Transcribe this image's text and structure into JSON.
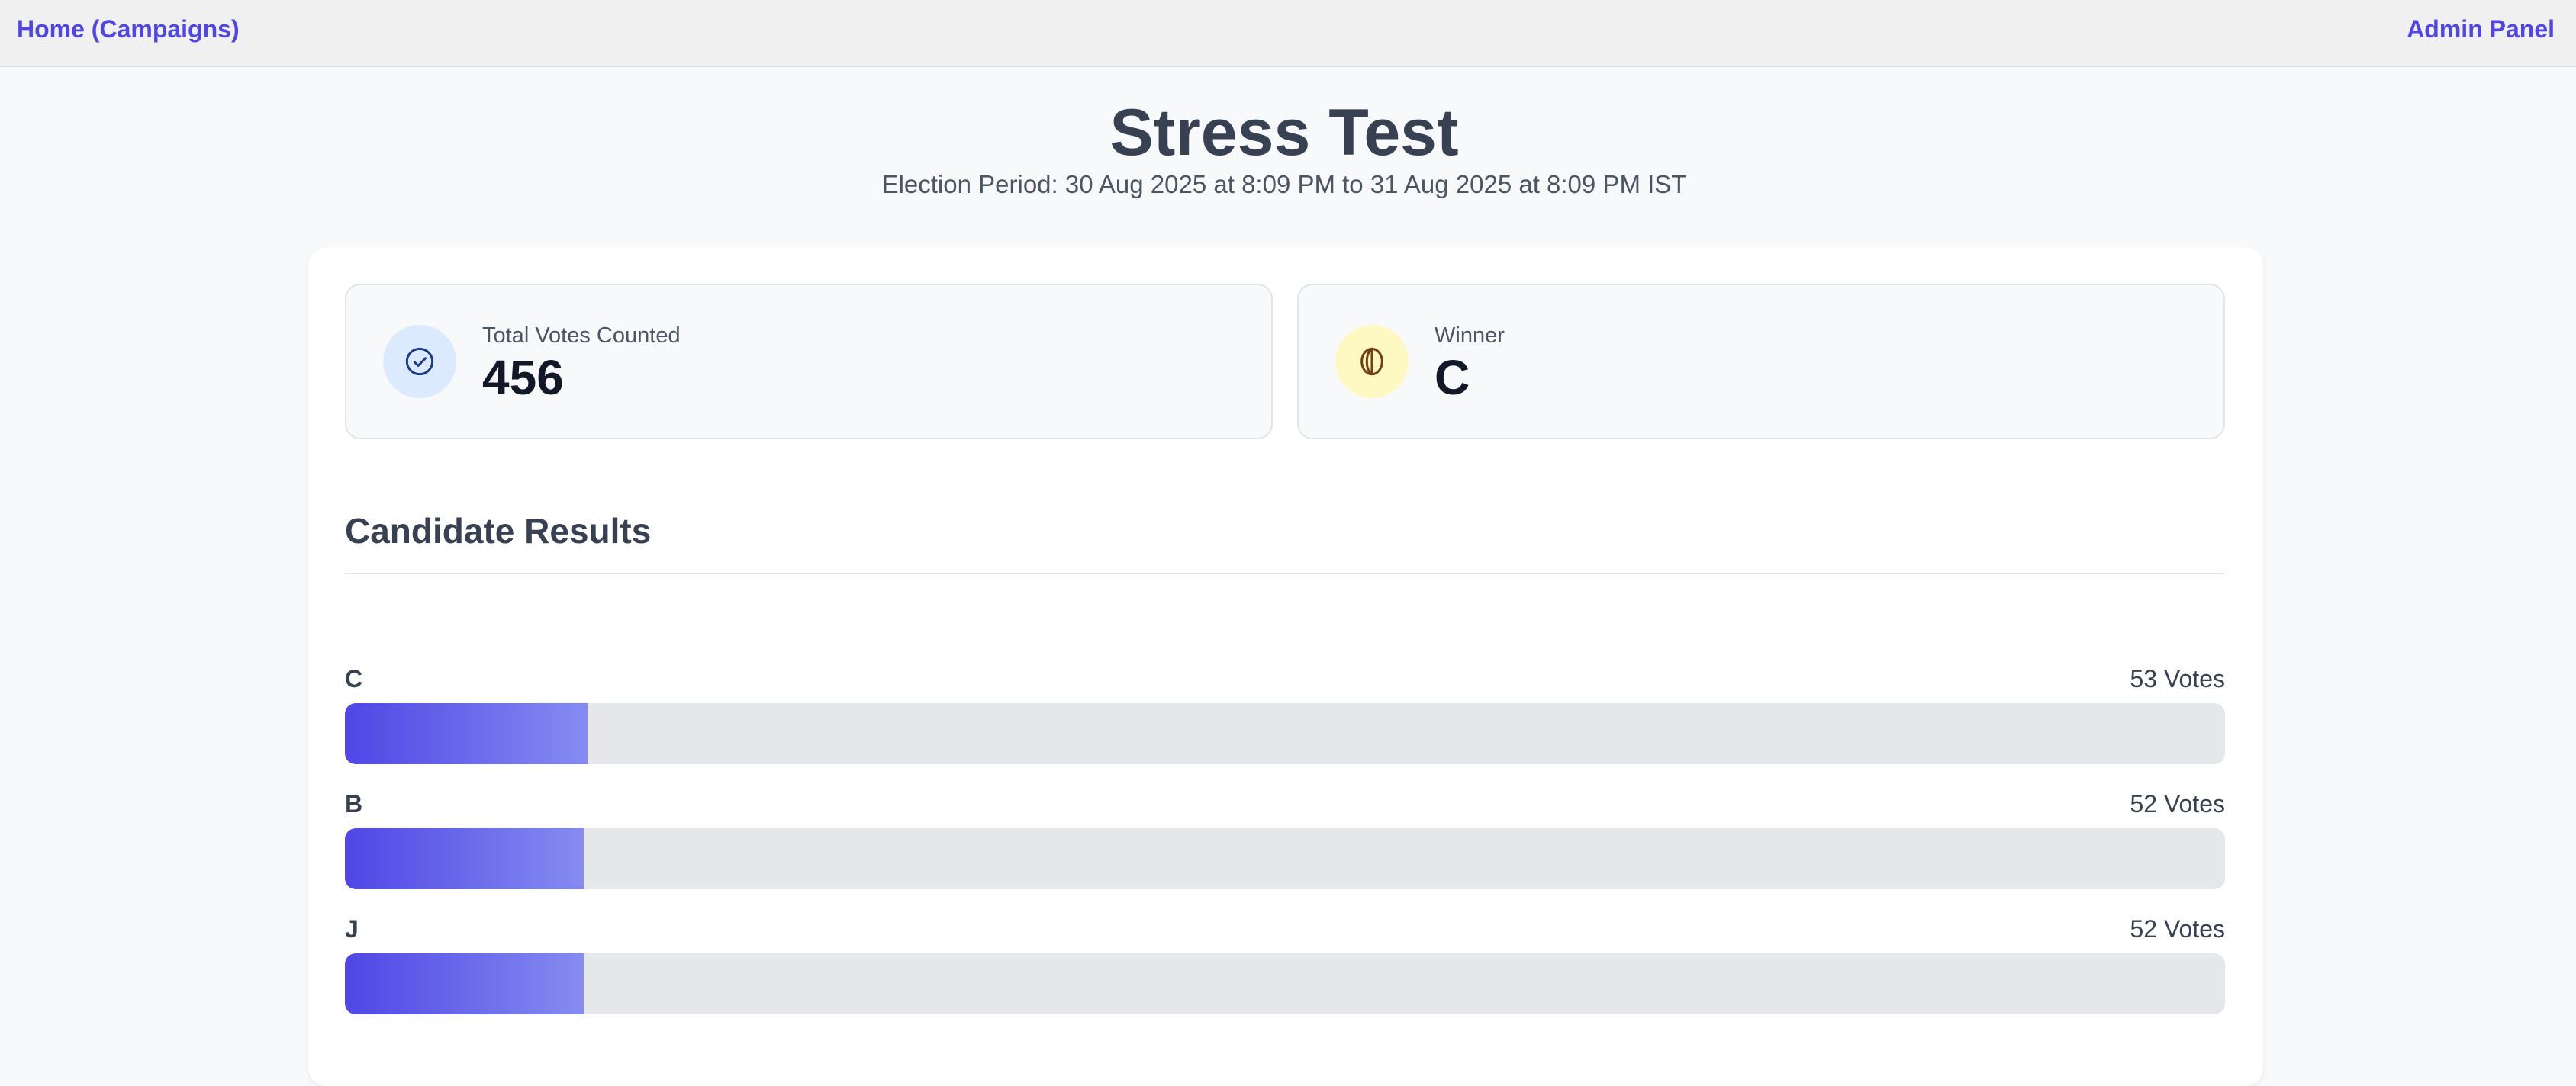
{
  "nav": {
    "home_label": "Home (Campaigns)",
    "admin_label": "Admin Panel"
  },
  "campaign": {
    "title": "Stress Test",
    "period": "Election Period: 30 Aug 2025 at 8:09 PM to 31 Aug 2025 at 8:09 PM IST"
  },
  "stats": {
    "total_votes": {
      "label": "Total Votes Counted",
      "value": "456",
      "icon": "check-circle-icon"
    },
    "winner": {
      "label": "Winner",
      "value": "C",
      "icon": "trophy-icon"
    }
  },
  "results": {
    "title": "Candidate Results",
    "candidates": [
      {
        "name": "C",
        "votes_label": "53 Votes",
        "share": 0.129
      },
      {
        "name": "B",
        "votes_label": "52 Votes",
        "share": 0.127
      },
      {
        "name": "J",
        "votes_label": "52 Votes",
        "share": 0.127
      }
    ]
  },
  "colors": {
    "accent": "#4f46e5",
    "bar_gradient_end": "#858cf0",
    "track": "#e5e7eb"
  }
}
